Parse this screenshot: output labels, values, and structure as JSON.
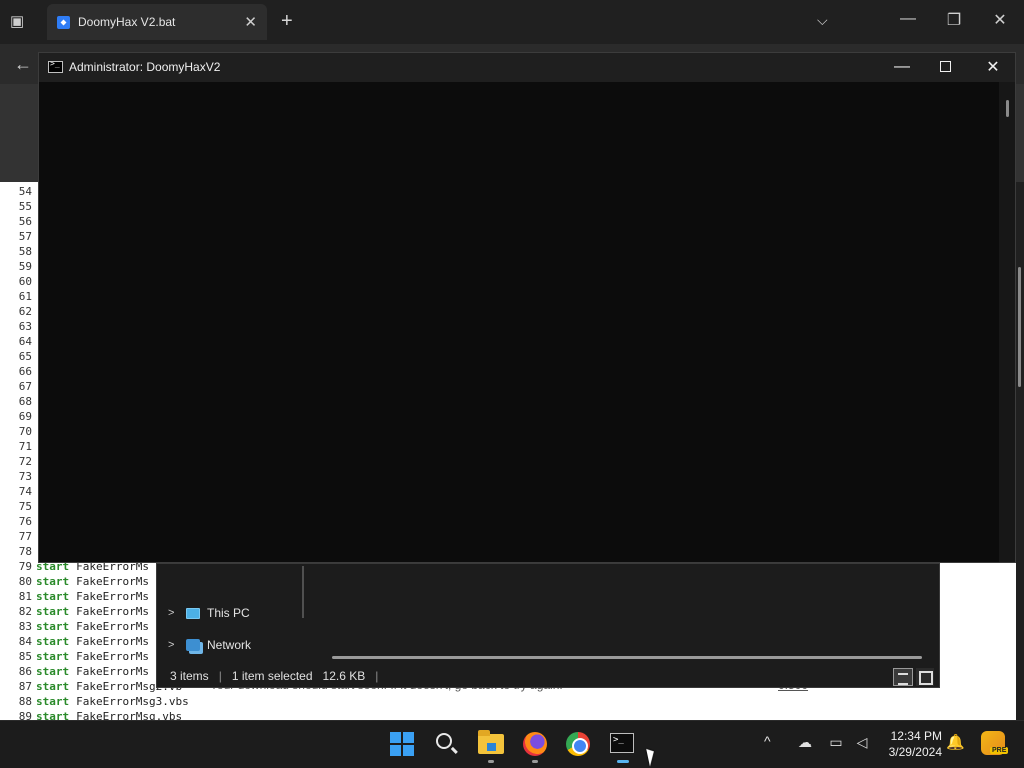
{
  "browser": {
    "tab_title": "DoomyHax V2.bat",
    "tab_close_glyph": "✕",
    "new_tab_glyph": "+",
    "dropdown_glyph": "⌵",
    "minimize_glyph": "—",
    "restore_glyph": "❐",
    "close_glyph": "✕",
    "back_glyph": "←"
  },
  "code": {
    "lines": [
      {
        "n": "54",
        "kw": "",
        "tx": ""
      },
      {
        "n": "55",
        "kw": "",
        "tx": ""
      },
      {
        "n": "56",
        "kw": "",
        "tx": ""
      },
      {
        "n": "57",
        "kw": "",
        "tx": ""
      },
      {
        "n": "58",
        "kw": "",
        "tx": ""
      },
      {
        "n": "59",
        "kw": "",
        "tx": ""
      },
      {
        "n": "60",
        "kw": "",
        "tx": ""
      },
      {
        "n": "61",
        "kw": "",
        "tx": ""
      },
      {
        "n": "62",
        "kw": "",
        "tx": ""
      },
      {
        "n": "63",
        "kw": "",
        "tx": ""
      },
      {
        "n": "64",
        "kw": "",
        "tx": ""
      },
      {
        "n": "65",
        "kw": "",
        "tx": ""
      },
      {
        "n": "66",
        "kw": "",
        "tx": ""
      },
      {
        "n": "67",
        "kw": "",
        "tx": ""
      },
      {
        "n": "68",
        "kw": "",
        "tx": ""
      },
      {
        "n": "69",
        "kw": "",
        "tx": ""
      },
      {
        "n": "70",
        "kw": "",
        "tx": ""
      },
      {
        "n": "71",
        "kw": "",
        "tx": ""
      },
      {
        "n": "72",
        "kw": "",
        "tx": ""
      },
      {
        "n": "73",
        "kw": "",
        "tx": ""
      },
      {
        "n": "74",
        "kw": "",
        "tx": ""
      },
      {
        "n": "75",
        "kw": "",
        "tx": ""
      },
      {
        "n": "76",
        "kw": "",
        "tx": ""
      },
      {
        "n": "77",
        "kw": "",
        "tx": ""
      },
      {
        "n": "78",
        "kw": "",
        "tx": ""
      },
      {
        "n": "79",
        "kw": "start",
        "tx": "FakeErrorMs"
      },
      {
        "n": "80",
        "kw": "start",
        "tx": "FakeErrorMs"
      },
      {
        "n": "81",
        "kw": "start",
        "tx": "FakeErrorMs"
      },
      {
        "n": "82",
        "kw": "start",
        "tx": "FakeErrorMs"
      },
      {
        "n": "83",
        "kw": "start",
        "tx": "FakeErrorMs"
      },
      {
        "n": "84",
        "kw": "start",
        "tx": "FakeErrorMs"
      },
      {
        "n": "85",
        "kw": "start",
        "tx": "FakeErrorMs"
      },
      {
        "n": "86",
        "kw": "start",
        "tx": "FakeErrorMs"
      },
      {
        "n": "87",
        "kw": "start",
        "tx": "FakeErrorMsg2.vb"
      },
      {
        "n": "88",
        "kw": "start",
        "tx": "FakeErrorMsg3.vbs"
      },
      {
        "n": "89",
        "kw": "start",
        "tx": "FakeErrorMsg.vbs"
      }
    ],
    "download_note": "Your download should start soon. If it doesn't, go back to try again.",
    "download_ref": "0.500"
  },
  "explorer": {
    "tree": [
      {
        "label": "This PC",
        "icon": "computer-icon"
      },
      {
        "label": "Network",
        "icon": "network-icon"
      }
    ],
    "status": {
      "items": "3 items",
      "selected": "1 item selected",
      "size": "12.6 KB"
    }
  },
  "console": {
    "title": "Administrator:  DoomyHaxV2",
    "minimize_glyph": "—",
    "close_glyph": "✕"
  },
  "taskbar": {
    "apps": [
      "start-icon",
      "search-icon",
      "file-explorer-icon",
      "firefox-icon",
      "chrome-icon",
      "terminal-icon"
    ],
    "tray_chevron": "^",
    "time": "12:34 PM",
    "date": "3/29/2024",
    "bell_glyph": "🔔",
    "copilot_badge": "PRE"
  }
}
